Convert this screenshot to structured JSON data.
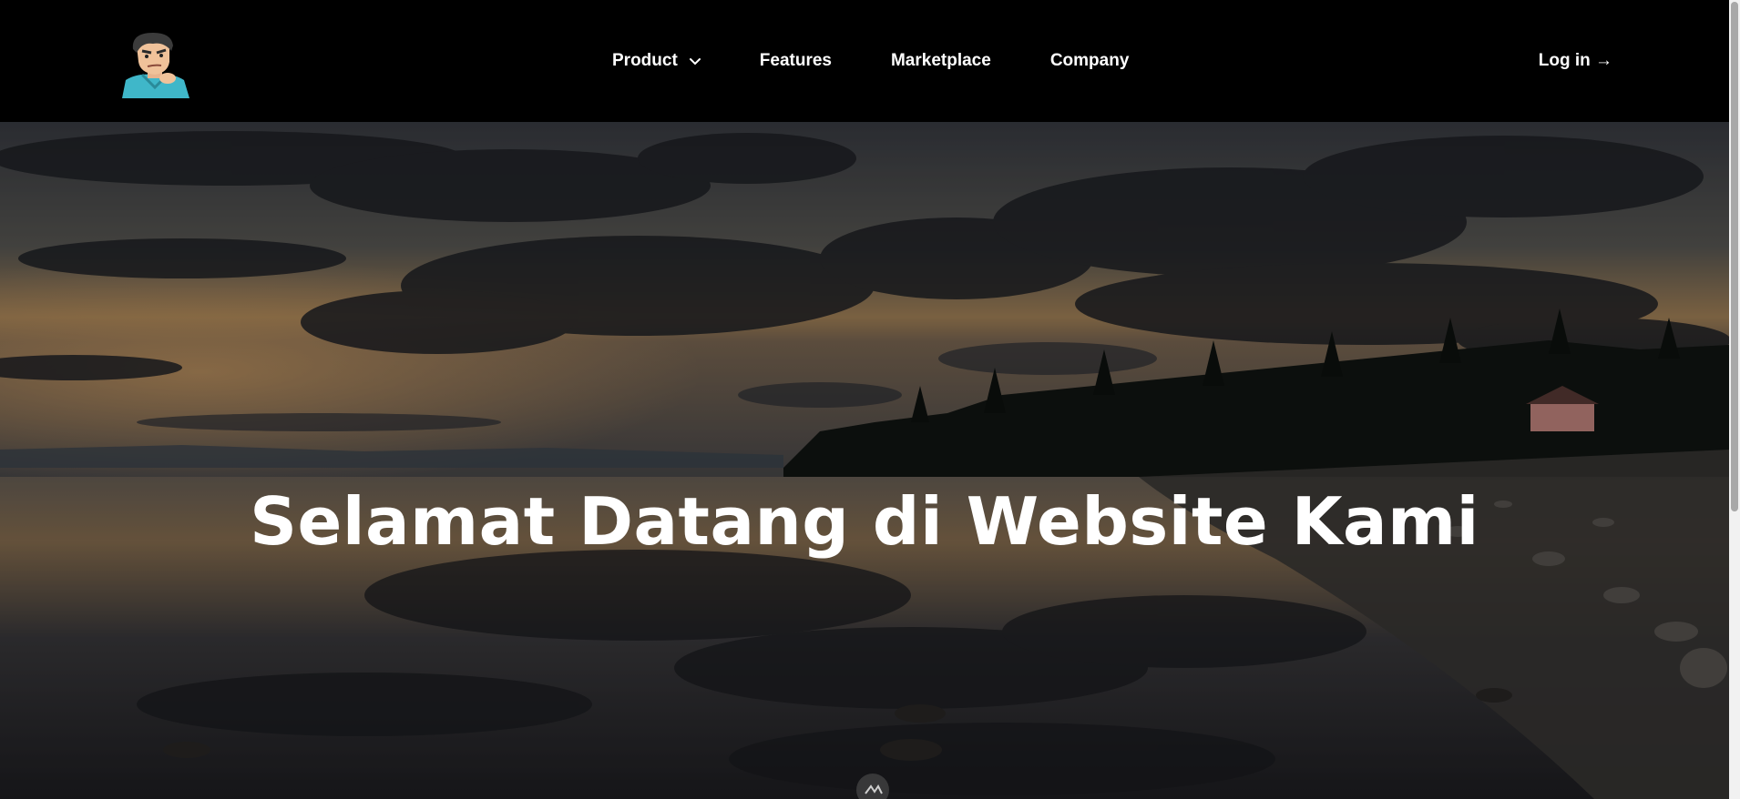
{
  "nav": {
    "logo_alt": "avatar logo",
    "items": [
      {
        "label": "Product",
        "has_dropdown": true
      },
      {
        "label": "Features"
      },
      {
        "label": "Marketplace"
      },
      {
        "label": "Company"
      }
    ],
    "login_label": "Log in →"
  },
  "hero": {
    "title": "Selamat Datang di Website Kami"
  },
  "colors": {
    "nav_bg": "#000000",
    "text": "#ffffff",
    "sky_glow": "#c8975a",
    "water": "#2b2b30"
  },
  "icons": [
    "chevron-down-icon",
    "scroll-down-icon"
  ]
}
